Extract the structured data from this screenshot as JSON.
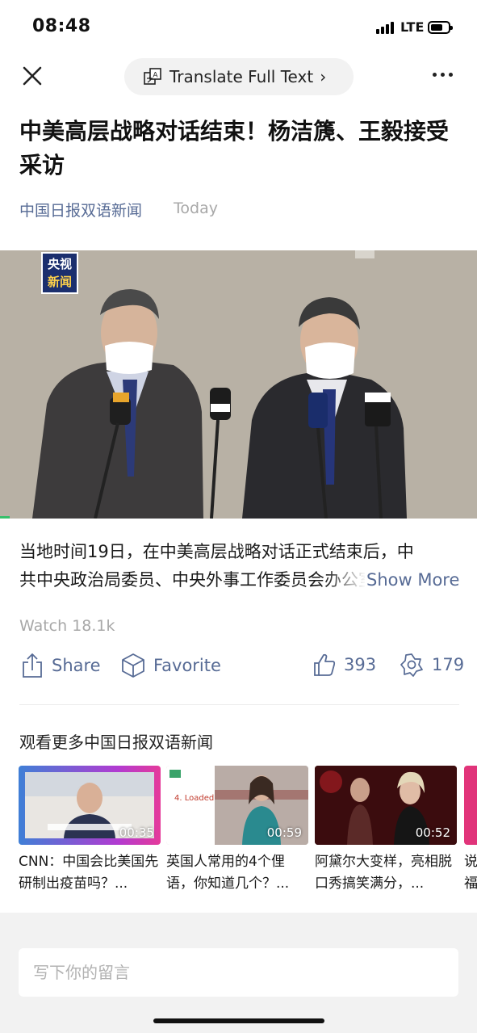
{
  "status_bar": {
    "time": "08:48",
    "network": "LTE"
  },
  "nav": {
    "close_icon": "close-icon",
    "translate_label": "Translate Full Text",
    "translate_chevron": "›",
    "more_icon": "more-dots-icon"
  },
  "article": {
    "title": "中美高层战略对话结束！杨洁篪、王毅接受采访",
    "source": "中国日报双语新闻",
    "date": "Today",
    "video_logo_line1": "央视",
    "video_logo_line2": "新闻",
    "video_progress_fraction": 0.02,
    "summary_line1": "当地时间19日，在中美高层战略对话正式结束后，中",
    "summary_line2": "共中央政治局委员、中央外事工作委员会办公室主任",
    "show_more": "Show More",
    "watch_count": "Watch 18.1k"
  },
  "actions": {
    "share_label": "Share",
    "favorite_label": "Favorite",
    "like_count": "393",
    "wow_count": "179"
  },
  "more_section": {
    "heading": "观看更多中国日报双语新闻",
    "items": [
      {
        "duration": "00:35",
        "caption": "CNN：中国会比美国先研制出疫苗吗？..."
      },
      {
        "duration": "00:59",
        "caption": "英国人常用的4个俚语，你知道几个？...",
        "slide_text": "4. Loaded"
      },
      {
        "duration": "00:52",
        "caption": "阿黛尔大变样，亮相脱口秀搞笑满分，..."
      },
      {
        "duration": "",
        "caption": "说福"
      }
    ]
  },
  "comment": {
    "placeholder": "写下你的留言"
  },
  "colors": {
    "link_blue": "#576b95",
    "muted_gray": "#a8a8a8",
    "progress_green": "#37c06b"
  }
}
